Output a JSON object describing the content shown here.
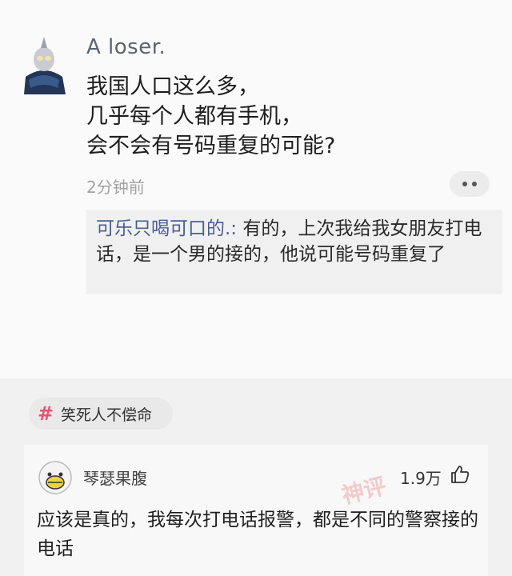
{
  "post": {
    "author": "A loser.",
    "question_lines": [
      "我国人口这么多，",
      "几乎每个人都有手机，",
      "会不会有号码重复的可能?"
    ],
    "time": "2分钟前",
    "more_icon": "more-dots-icon",
    "reply": {
      "user": "可乐只喝可口的.:",
      "text": " 有的，上次我给我女朋友打电话，是一个男的接的，他说可能号码重复了"
    }
  },
  "topic": {
    "icon": "hash-icon",
    "label": "笑死人不偿命"
  },
  "comment": {
    "user": "琴瑟果腹",
    "likes": "1.9万",
    "like_icon": "thumbs-up-icon",
    "text": "应该是真的，我每次打电话报警，都是不同的警察接的电话",
    "stamp": "神评"
  },
  "colors": {
    "author": "#5a6472",
    "reply_user": "#4b5f8f",
    "topic_hash": "#e8546b"
  }
}
